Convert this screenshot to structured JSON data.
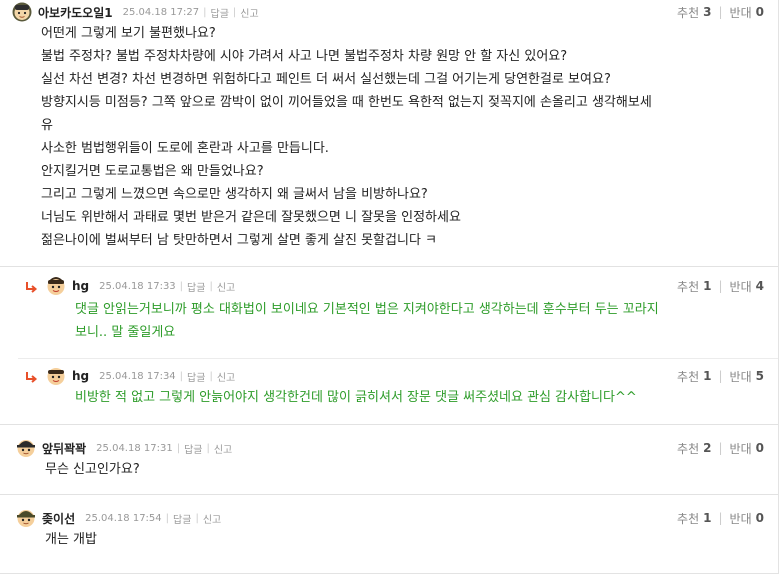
{
  "actions": {
    "reply": "답글",
    "report": "신고",
    "up": "추천",
    "down": "반대"
  },
  "comments": [
    {
      "nick": "아보카도오일1",
      "date": "25.04.18 17:27",
      "up": "3",
      "down": "0",
      "lines": [
        "어떤게 그렇게 보기 불편했나요?",
        "불법 주정차? 불법 주정차차량에 시야 가려서 사고 나면 불법주정차 차량 원망 안 할 자신 있어요?",
        "실선 차선 변경? 차선 변경하면 위험하다고 페인트 더 써서 실선했는데 그걸 어기는게 당연한걸로 보여요?",
        "방향지시등 미점등? 그쪽 앞으로 깜박이 없이 끼어들었을 때 한번도 욕한적 없는지 젖꼭지에 손올리고 생각해보세",
        "유",
        "사소한 범법행위들이 도로에 혼란과 사고를 만듭니다.",
        "안지킬거면 도로교통법은 왜 만들었나요?",
        "그리고 그렇게 느꼈으면 속으로만 생각하지 왜 글써서 남을 비방하나요?",
        "너님도 위반해서 과태료 몇번 받은거 같은데 잘못했으면 니 잘못을 인정하세요",
        "젊은나이에 벌써부터 남 탓만하면서 그렇게 살면 좋게 살진 못할겁니다 ㅋ"
      ]
    },
    {
      "nick": "hg",
      "date": "25.04.18 17:33",
      "up": "1",
      "down": "4",
      "lines": [
        "댓글 안읽는거보니까 평소 대화법이 보이네요 기본적인 법은 지켜야한다고 생각하는데 훈수부터 두는 꼬라지",
        "보니.. 말 줄일게요"
      ]
    },
    {
      "nick": "hg",
      "date": "25.04.18 17:34",
      "up": "1",
      "down": "5",
      "lines": [
        "비방한 적 없고 그렇게 안늙어야지 생각한건데 많이 긁히셔서 장문 댓글 써주셨네요 관심 감사합니다^^"
      ]
    },
    {
      "nick": "앞뒤꽉꽉",
      "date": "25.04.18 17:31",
      "up": "2",
      "down": "0",
      "lines": [
        "무슨 신고인가요?"
      ]
    },
    {
      "nick": "좆이선",
      "date": "25.04.18 17:54",
      "up": "1",
      "down": "0",
      "lines": [
        "개는 개밥"
      ]
    }
  ],
  "colors": {
    "reply_text": "#2e9c2a",
    "reply_arrow": "#e8502a",
    "meta": "#999999"
  },
  "icons": {
    "avatar": "avatar-icon",
    "reply_arrow": "reply-arrow-icon"
  }
}
